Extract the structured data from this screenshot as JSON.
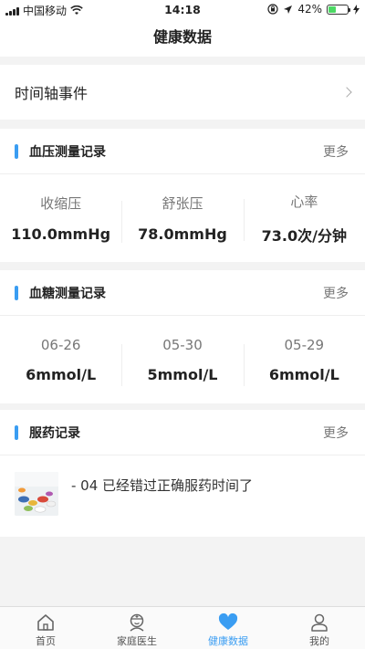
{
  "status_bar": {
    "carrier": "中国移动",
    "time": "14:18",
    "battery": "42%",
    "battery_level": 0.42
  },
  "nav": {
    "title": "健康数据"
  },
  "timeline": {
    "label": "时间轴事件"
  },
  "blood_pressure": {
    "title": "血压测量记录",
    "more": "更多",
    "metrics": [
      {
        "label": "收缩压",
        "value": "110.0mmHg"
      },
      {
        "label": "舒张压",
        "value": "78.0mmHg"
      },
      {
        "label": "心率",
        "value": "73.0次/分钟"
      }
    ]
  },
  "blood_sugar": {
    "title": "血糖测量记录",
    "more": "更多",
    "metrics": [
      {
        "label": "06-26",
        "value": "6mmol/L"
      },
      {
        "label": "05-30",
        "value": "5mmol/L"
      },
      {
        "label": "05-29",
        "value": "6mmol/L"
      }
    ]
  },
  "medication": {
    "title": "服药记录",
    "more": "更多",
    "items": [
      {
        "text": "- 04 已经错过正确服药时间了"
      }
    ]
  },
  "tabbar": {
    "tabs": [
      {
        "label": "首页",
        "icon": "home-icon"
      },
      {
        "label": "家庭医生",
        "icon": "doctor-icon"
      },
      {
        "label": "健康数据",
        "icon": "heart-icon"
      },
      {
        "label": "我的",
        "icon": "user-icon"
      }
    ]
  },
  "colors": {
    "accent": "#3a9df2",
    "battery": "#4cd964"
  }
}
